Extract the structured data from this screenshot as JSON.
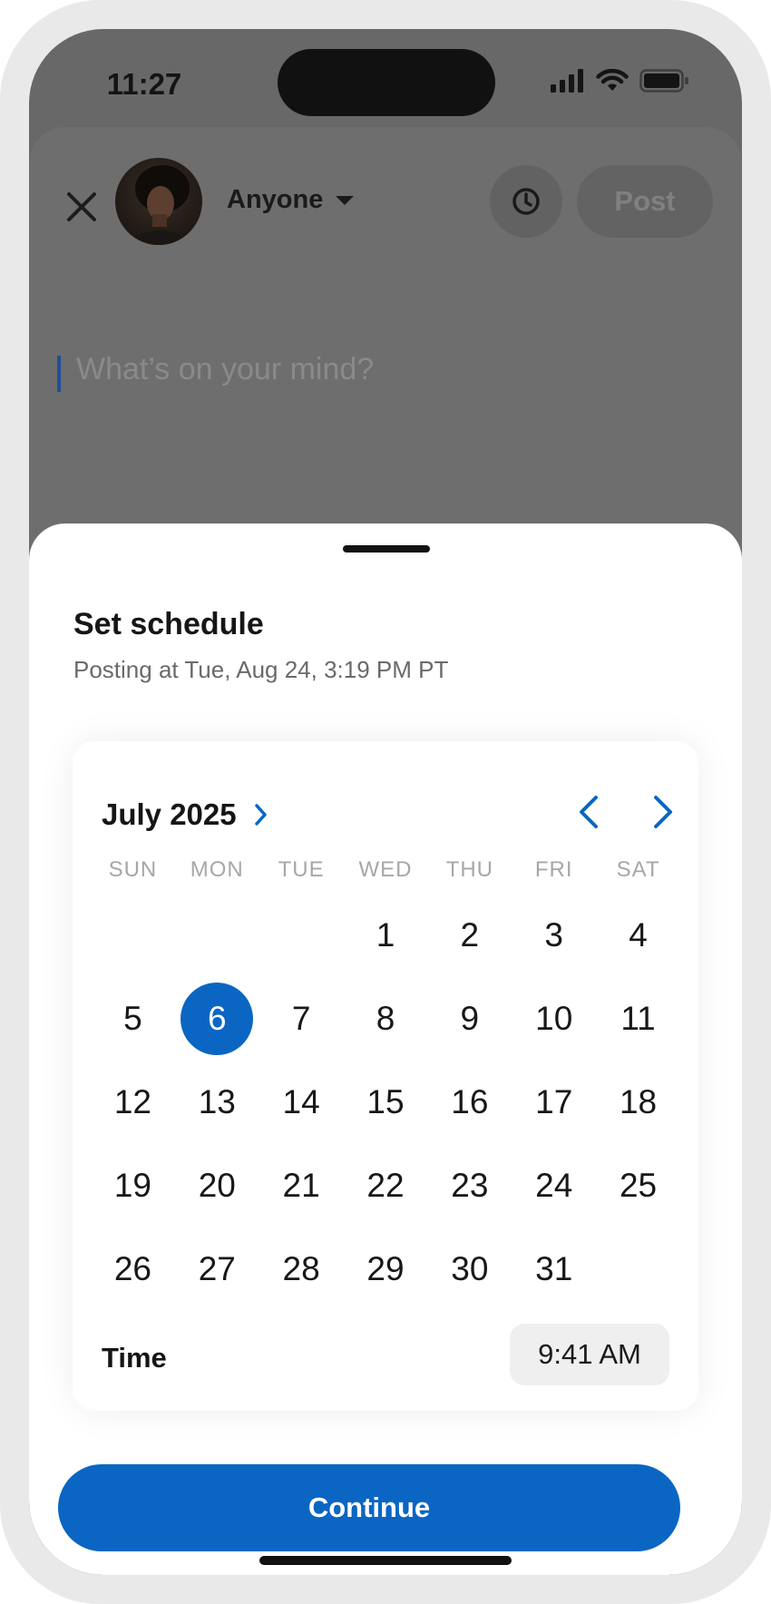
{
  "status_bar": {
    "time": "11:27"
  },
  "compose": {
    "audience_label": "Anyone",
    "post_label": "Post",
    "placeholder": "What’s on your mind?"
  },
  "schedule": {
    "title": "Set schedule",
    "subtitle": "Posting at Tue, Aug 24, 3:19 PM PT",
    "month_label": "July 2025",
    "weekdays": [
      "SUN",
      "MON",
      "TUE",
      "WED",
      "THU",
      "FRI",
      "SAT"
    ],
    "days": [
      "",
      "",
      "",
      "1",
      "2",
      "3",
      "4",
      "5",
      "6",
      "7",
      "8",
      "9",
      "10",
      "11",
      "12",
      "13",
      "14",
      "15",
      "16",
      "17",
      "18",
      "19",
      "20",
      "21",
      "22",
      "23",
      "24",
      "25",
      "26",
      "27",
      "28",
      "29",
      "30",
      "31",
      ""
    ],
    "selected_day": "6",
    "time_label": "Time",
    "time_value": "9:41 AM"
  },
  "actions": {
    "continue_label": "Continue"
  },
  "icons": {
    "close": "close-icon",
    "dropdown": "caret-down-icon",
    "clock": "clock-icon",
    "month_expand": "chevron-right-icon",
    "prev_month": "chevron-left-icon",
    "next_month": "chevron-right-icon",
    "signal": "cellular-signal-icon",
    "wifi": "wifi-icon",
    "battery": "battery-icon"
  },
  "colors": {
    "accent": "#0a66c2",
    "overlay": "#686868",
    "surface": "#ffffff"
  }
}
